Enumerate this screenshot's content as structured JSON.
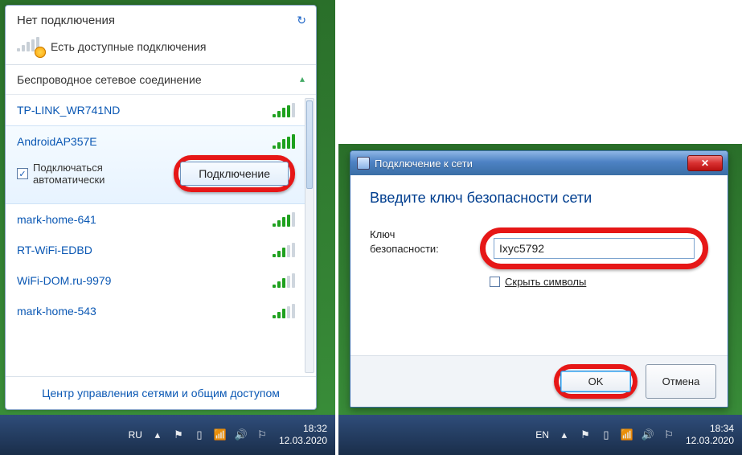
{
  "left": {
    "no_connection": "Нет подключения",
    "available": "Есть доступные подключения",
    "section": "Беспроводное сетевое соединение",
    "networks": [
      {
        "ssid": "TP-LINK_WR741ND",
        "signal": 4,
        "selected": false
      },
      {
        "ssid": "AndroidAP357E",
        "signal": 5,
        "selected": true
      },
      {
        "ssid": "mark-home-641",
        "signal": 4,
        "selected": false
      },
      {
        "ssid": "RT-WiFi-EDBD",
        "signal": 3,
        "selected": false
      },
      {
        "ssid": "WiFi-DOM.ru-9979",
        "signal": 3,
        "selected": false
      },
      {
        "ssid": "mark-home-543",
        "signal": 3,
        "selected": false
      }
    ],
    "auto_connect_label": "Подключаться\nавтоматически",
    "auto_connect_checked": true,
    "connect_button": "Подключение",
    "footer_link": "Центр управления сетями и общим доступом",
    "taskbar": {
      "lang": "RU",
      "time": "18:32",
      "date": "12.03.2020"
    }
  },
  "right": {
    "title": "Подключение к сети",
    "heading": "Введите ключ безопасности сети",
    "key_label": "Ключ безопасности:",
    "key_value": "Ixyc5792",
    "hide_label": "Скрыть символы",
    "hide_checked": false,
    "ok": "OK",
    "cancel": "Отмена",
    "taskbar": {
      "lang": "EN",
      "time": "18:34",
      "date": "12.03.2020"
    }
  }
}
